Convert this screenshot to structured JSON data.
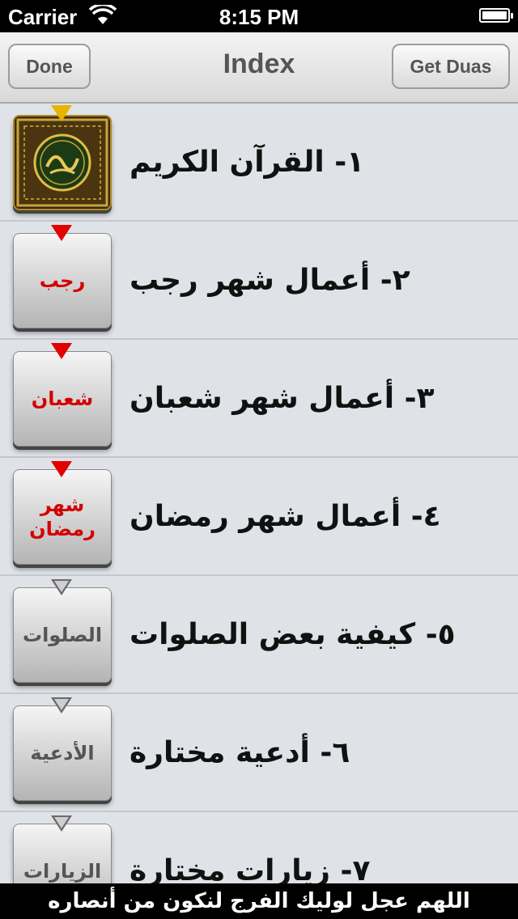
{
  "status_bar": {
    "carrier": "Carrier",
    "time": "8:15 PM",
    "wifi_icon": "wifi-icon",
    "battery_icon": "battery-icon"
  },
  "navbar": {
    "title": "Index",
    "left_button": "Done",
    "right_button": "Get Duas"
  },
  "rows": [
    {
      "label": "١- القرآن الكريم",
      "tile_text": "",
      "tile_style": "quran",
      "marker": "gold"
    },
    {
      "label": "٢- أعمال شهر رجب",
      "tile_text": "رجب",
      "tile_style": "red",
      "marker": "red"
    },
    {
      "label": "٣- أعمال شهر شعبان",
      "tile_text": "شعبان",
      "tile_style": "red",
      "marker": "red"
    },
    {
      "label": "٤- أعمال شهر رمضان",
      "tile_text": "شهر رمضان",
      "tile_style": "red",
      "marker": "red"
    },
    {
      "label": "٥- كيفية بعض الصلوات",
      "tile_text": "الصلوات",
      "tile_style": "gray",
      "marker": "gray"
    },
    {
      "label": "٦- أدعية مختارة",
      "tile_text": "الأدعية",
      "tile_style": "gray",
      "marker": "gray"
    },
    {
      "label": "٧- زيارات مختارة",
      "tile_text": "الزيارات",
      "tile_style": "gray",
      "marker": "gray"
    }
  ],
  "footer": {
    "text": "اللهم عجل لوليك الفرج لنكون من أنصاره"
  },
  "colors": {
    "accent_red": "#e30000",
    "accent_gold": "#e8b400",
    "list_background": "#dfe3e8"
  }
}
